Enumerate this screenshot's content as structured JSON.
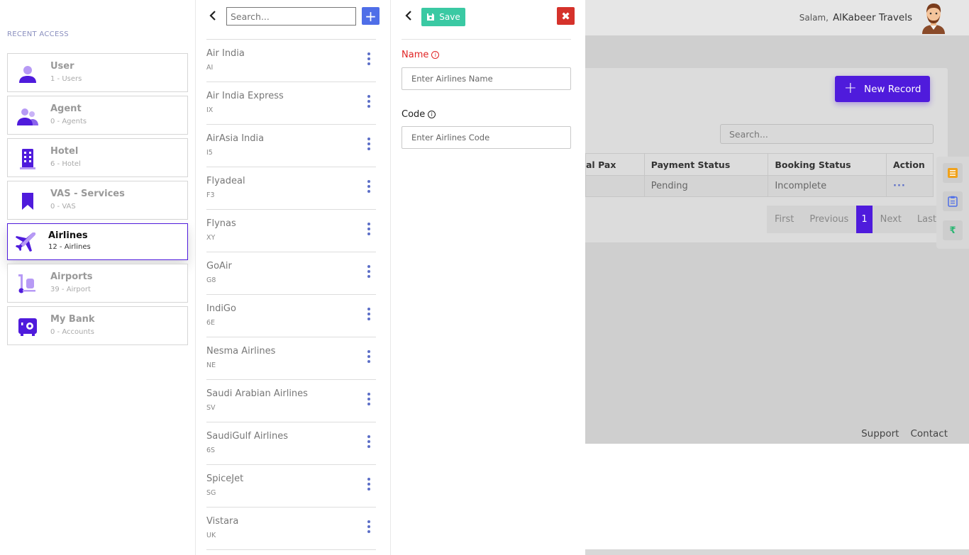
{
  "header": {
    "greeting": "Salam,",
    "company": "AlKabeer Travels"
  },
  "background": {
    "new_record_label": "New Record",
    "search_placeholder": "Search...",
    "table": {
      "columns": [
        "al Pax",
        "Payment Status",
        "Booking Status",
        "Action"
      ],
      "rows": [
        {
          "pax": "",
          "payment_status": "Pending",
          "booking_status": "Incomplete",
          "action": "···"
        }
      ]
    },
    "pagination": [
      "First",
      "Previous",
      "1",
      "Next",
      "Last"
    ],
    "footer": {
      "support": "Support",
      "contact": "Contact"
    },
    "side_tools": [
      {
        "icon": "list-icon",
        "color": "#f0a21b"
      },
      {
        "icon": "clipboard-icon",
        "color": "#4f6ee8"
      },
      {
        "icon": "rupee-icon",
        "color": "#2bb673"
      }
    ]
  },
  "recent_access": {
    "title": "RECENT ACCESS",
    "items": [
      {
        "name": "User",
        "sub": "1 - Users",
        "icon": "user-icon"
      },
      {
        "name": "Agent",
        "sub": "0 - Agents",
        "icon": "agents-icon"
      },
      {
        "name": "Hotel",
        "sub": "6 - Hotel",
        "icon": "hotel-icon"
      },
      {
        "name": "VAS - Services",
        "sub": "0 - VAS",
        "icon": "bookmark-icon"
      },
      {
        "name": "Airlines",
        "sub": "12 - Airlines",
        "icon": "airplane-icon",
        "active": true
      },
      {
        "name": "Airports",
        "sub": "39 - Airport",
        "icon": "luggage-icon"
      },
      {
        "name": "My Bank",
        "sub": "0 - Accounts",
        "icon": "safe-icon"
      }
    ]
  },
  "airline_list": {
    "search_placeholder": "Search...",
    "items": [
      {
        "name": "Air India",
        "code": "AI"
      },
      {
        "name": "Air India Express",
        "code": "IX"
      },
      {
        "name": "AirAsia India",
        "code": "I5"
      },
      {
        "name": "Flyadeal",
        "code": "F3"
      },
      {
        "name": "Flynas",
        "code": "XY"
      },
      {
        "name": "GoAir",
        "code": "G8"
      },
      {
        "name": "IndiGo",
        "code": "6E"
      },
      {
        "name": "Nesma Airlines",
        "code": "NE"
      },
      {
        "name": "Saudi Arabian Airlines",
        "code": "SV"
      },
      {
        "name": "SaudiGulf Airlines",
        "code": "6S"
      },
      {
        "name": "SpiceJet",
        "code": "SG"
      },
      {
        "name": "Vistara",
        "code": "UK"
      }
    ]
  },
  "form": {
    "save_label": "Save",
    "name_label": "Name",
    "name_placeholder": "Enter Airlines Name",
    "code_label": "Code",
    "code_placeholder": "Enter Airlines Code"
  },
  "colors": {
    "accent": "#4f1bdc",
    "save": "#3ac9a3",
    "close": "#d5322b",
    "add": "#4f6ee8",
    "required": "#e02424"
  }
}
